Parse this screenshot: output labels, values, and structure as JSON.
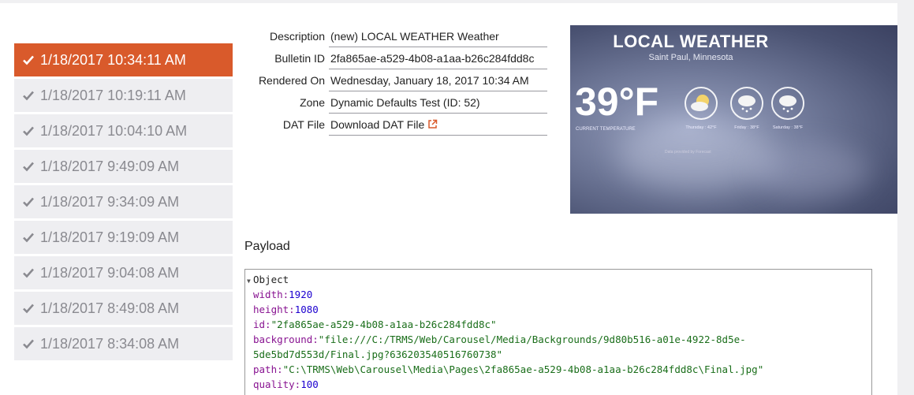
{
  "history": [
    {
      "label": "1/18/2017 10:34:11 AM",
      "active": true
    },
    {
      "label": "1/18/2017 10:19:11 AM",
      "active": false
    },
    {
      "label": "1/18/2017 10:04:10 AM",
      "active": false
    },
    {
      "label": "1/18/2017 9:49:09 AM",
      "active": false
    },
    {
      "label": "1/18/2017 9:34:09 AM",
      "active": false
    },
    {
      "label": "1/18/2017 9:19:09 AM",
      "active": false
    },
    {
      "label": "1/18/2017 9:04:08 AM",
      "active": false
    },
    {
      "label": "1/18/2017 8:49:08 AM",
      "active": false
    },
    {
      "label": "1/18/2017 8:34:08 AM",
      "active": false
    }
  ],
  "info": {
    "description_label": "Description",
    "description_value": "(new) LOCAL WEATHER Weather",
    "bulletin_label": "Bulletin ID",
    "bulletin_value": "2fa865ae-a529-4b08-a1aa-b26c284fdd8c",
    "rendered_label": "Rendered On",
    "rendered_value": "Wednesday, January 18, 2017 10:34 AM",
    "zone_label": "Zone",
    "zone_value": "Dynamic Defaults Test (ID: 52)",
    "dat_label": "DAT File",
    "dat_link": "Download DAT File",
    "dat_icon": "external-link-icon"
  },
  "preview": {
    "title": "LOCAL WEATHER",
    "subtitle": "Saint Paul, Minnesota",
    "temperature": "39°F",
    "current_label": "CURRENT TEMPERATURE",
    "days": [
      {
        "label": "Thursday : 42°F",
        "icon": "partly-sunny-icon"
      },
      {
        "label": "Friday : 38°F",
        "icon": "snow-cloud-icon"
      },
      {
        "label": "Saturday : 38°F",
        "icon": "snow-cloud-icon"
      }
    ],
    "credit": "Data provided by Forecast"
  },
  "payload": {
    "title": "Payload",
    "root": "Object",
    "fields": [
      {
        "key": "width:",
        "value": "1920",
        "type": "num"
      },
      {
        "key": "height:",
        "value": "1080",
        "type": "num"
      },
      {
        "key": "id:",
        "value": "\"2fa865ae-a529-4b08-a1aa-b26c284fdd8c\"",
        "type": "str"
      },
      {
        "key": "background:",
        "value": "\"file:///C:/TRMS/Web/Carousel/Media/Backgrounds/9d80b516-a01e-4922-8d5e-",
        "type": "str"
      },
      {
        "key": "",
        "value": "5de5bd7d553d/Final.jpg?636203540516760738\"",
        "type": "str"
      },
      {
        "key": "path:",
        "value": "\"C:\\TRMS\\Web\\Carousel\\Media\\Pages\\2fa865ae-a529-4b08-a1aa-b26c284fdd8c\\Final.jpg\"",
        "type": "str"
      },
      {
        "key": "quality:",
        "value": "100",
        "type": "num"
      }
    ]
  },
  "colors": {
    "active": "#d95a2b",
    "inactive_bg": "#eeeef1",
    "inactive_text": "#8a8a90"
  }
}
